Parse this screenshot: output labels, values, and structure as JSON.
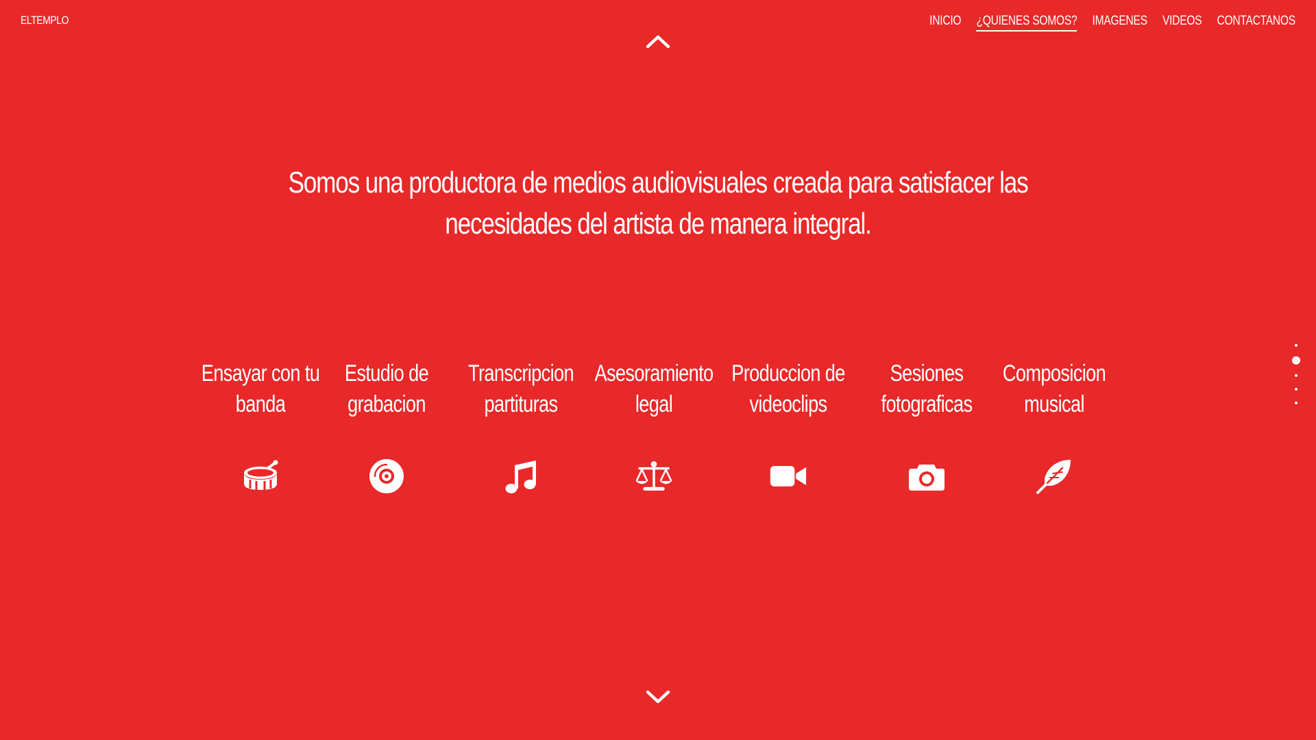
{
  "brand": "ELTEMPLO",
  "nav": [
    {
      "label": "INICIO",
      "active": false
    },
    {
      "label": "¿QUIENES SOMOS?",
      "active": true
    },
    {
      "label": "IMAGENES",
      "active": false
    },
    {
      "label": "VIDEOS",
      "active": false
    },
    {
      "label": "CONTACTANOS",
      "active": false
    }
  ],
  "headline": "Somos una productora de medios audiovisuales creada para satisfacer las necesidades del artista de manera integral.",
  "services": [
    {
      "label": "Ensayar con tu\nbanda",
      "icon": "drum-icon"
    },
    {
      "label": "Estudio de\ngrabacion",
      "icon": "compact-disc-icon"
    },
    {
      "label": "Transcripcion\npartituras",
      "icon": "music-note-icon"
    },
    {
      "label": "Asesoramiento\nlegal",
      "icon": "balance-scale-icon"
    },
    {
      "label": "Produccion de\nvideoclips",
      "icon": "video-camera-icon"
    },
    {
      "label": "Sesiones\nfotograficas",
      "icon": "camera-icon"
    },
    {
      "label": "Composicion\nmusical",
      "icon": "feather-icon"
    }
  ],
  "section_dots": {
    "count": 5,
    "active_index": 1
  },
  "colors": {
    "background": "#e82829",
    "foreground": "#ffffff"
  }
}
